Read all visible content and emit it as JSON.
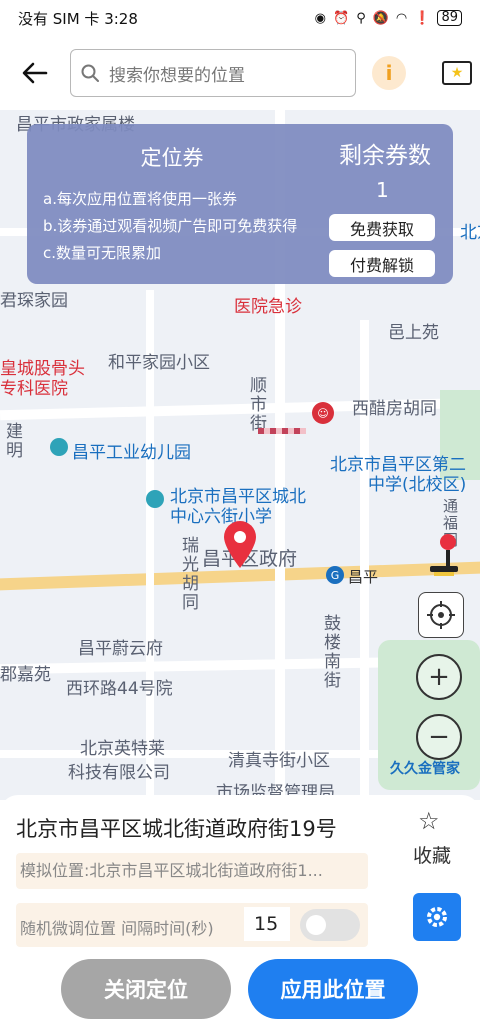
{
  "status_bar": {
    "carrier_time": "没有 SIM 卡 3:28",
    "battery": "89"
  },
  "top_bar": {
    "search_placeholder": "搜索你想要的位置",
    "info_icon_text": "i"
  },
  "coupon": {
    "title": "定位券",
    "rules": [
      "a.每次应用位置将使用一张券",
      "b.该券通过观看视频广告即可免费获得",
      "c.数量可无限累加"
    ],
    "remaining_label": "剩余券数",
    "remaining_count": "1",
    "free_button": "免费获取",
    "paid_button": "付费解锁"
  },
  "map": {
    "labels": [
      "昌平市政家属楼",
      "君琛家园",
      "医院急诊",
      "邑上苑",
      "皇城股骨头",
      "专科医院",
      "和平家园小区",
      "顺市街",
      "西醋房胡同",
      "昌平工业幼儿园",
      "北京市昌平区第二",
      "中学(北校区)",
      "北京市昌平区城北",
      "中心六街小学",
      "瑞光胡同",
      "昌平区政府",
      "昌平",
      "昌平蔚云府",
      "郡嘉苑",
      "西环路44号院",
      "鼓楼南街",
      "北京英特莱",
      "科技有限公司",
      "清真寺街小区",
      "久久金管家",
      "市场监督管理局",
      "通福同",
      "北京市昌平",
      "建明"
    ]
  },
  "bottom": {
    "address": "北京市昌平区城北街道政府街19号",
    "favorite_label": "收藏",
    "simulated_location": "模拟位置:北京市昌平区城北街道政府街1...",
    "random_label": "随机微调位置 间隔时间(秒)",
    "interval_value": "15",
    "close_button": "关闭定位",
    "apply_button": "应用此位置"
  },
  "colors": {
    "primary": "#1f7ff0",
    "coupon_bg": "#7e8bbf",
    "marker": "#e8303f",
    "disabled": "#a6a6a6"
  }
}
